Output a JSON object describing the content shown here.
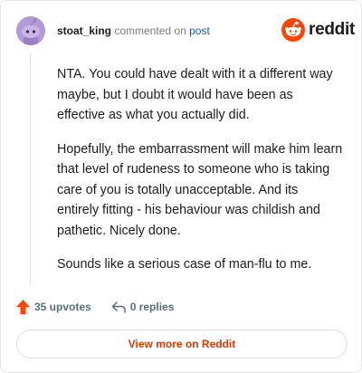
{
  "comment": {
    "username": "stoat_king",
    "action_text": "commented on",
    "post_link": "post",
    "paragraphs": [
      "NTA. You could have dealt with it a different way maybe, but I doubt it would have been as effective as what you actually did.",
      "Hopefully, the embarrassment will make him learn that level of rudeness to someone who is taking care of you is totally unacceptable. And its entirely fitting - his behaviour was childish and pathetic. Nicely done.",
      "Sounds like a serious case of man-flu to me."
    ]
  },
  "brand": {
    "wordmark": "reddit",
    "color": "#ff4500"
  },
  "footer": {
    "upvotes": "35 upvotes",
    "replies": "0 replies"
  },
  "view_more_label": "View more on Reddit",
  "icons": {
    "avatar": "snoo-avatar-icon",
    "logo": "reddit-logo-icon",
    "upvote": "upvote-arrow-icon",
    "reply": "reply-arrow-icon"
  }
}
